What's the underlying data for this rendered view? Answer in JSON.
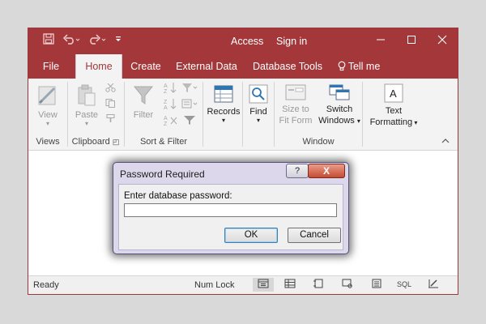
{
  "window": {
    "app_title": "Access",
    "sign_in": "Sign in",
    "quick_access": [
      "save-icon",
      "undo-icon",
      "redo-icon",
      "customize-icon"
    ],
    "controls": [
      "minimize-icon",
      "maximize-icon",
      "close-icon"
    ]
  },
  "tabs": [
    "File",
    "Home",
    "Create",
    "External Data",
    "Database Tools",
    "Tell me"
  ],
  "ribbon": {
    "groups": {
      "views": "Views",
      "clipboard": "Clipboard",
      "sort_filter": "Sort & Filter",
      "window": "Window"
    },
    "buttons": {
      "view": "View",
      "paste": "Paste",
      "filter": "Filter",
      "records": "Records",
      "find": "Find",
      "size_to_fit_1": "Size to",
      "size_to_fit_2": "Fit Form",
      "switch_windows_1": "Switch",
      "switch_windows_2": "Windows",
      "text_formatting_1": "Text",
      "text_formatting_2": "Formatting"
    }
  },
  "statusbar": {
    "ready": "Ready",
    "num_lock": "Num Lock",
    "sql_label": "SQL"
  },
  "dialog": {
    "title": "Password Required",
    "help_label": "?",
    "close_label": "X",
    "prompt": "Enter database password:",
    "password_value": "",
    "ok_label": "OK",
    "cancel_label": "Cancel"
  },
  "colors": {
    "brand": "#a4373a",
    "ribbon_bg": "#f3f3f3",
    "dialog_frame": "#dcd7ea"
  }
}
